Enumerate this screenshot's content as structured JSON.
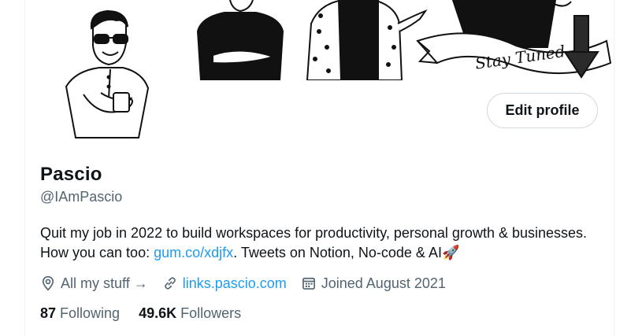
{
  "profile": {
    "name": "Pascio",
    "handle": "@IAmPascio",
    "bio_text_1": "Quit my job in 2022 to build workspaces for productivity, personal growth & businesses. How you can too: ",
    "bio_link": "gum.co/xdjfx",
    "bio_text_2": ". Tweets on Notion, No-code & AI",
    "bio_emoji": "🚀",
    "edit_button_label": "Edit profile"
  },
  "meta": {
    "location_label": "All my stuff →",
    "website_label": "links.pascio.com",
    "joined_label": "Joined August 2021"
  },
  "stats": {
    "following_count": "87",
    "following_label": "Following",
    "followers_count": "49.6K",
    "followers_label": "Followers"
  },
  "banner": {
    "stay_tuned_text": "Stay Tuned"
  },
  "colors": {
    "link": "#1d9bf0",
    "secondary_text": "#536471",
    "primary_text": "#0f1419",
    "border": "#cfd9de"
  },
  "icons": [
    "location-pin-icon",
    "link-icon",
    "calendar-icon"
  ]
}
